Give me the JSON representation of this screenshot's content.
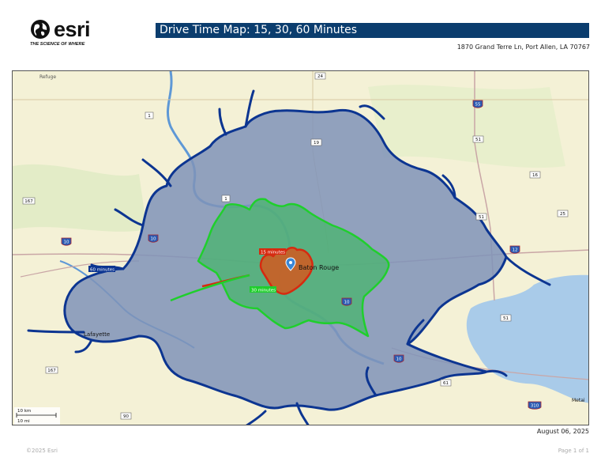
{
  "header": {
    "logo_word": "esri",
    "logo_tagline": "THE SCIENCE OF WHERE",
    "title": "Drive Time Map: 15, 30, 60 Minutes",
    "address": "1870 Grand Terre Ln, Port Allen, LA 70767"
  },
  "map": {
    "places": {
      "baton_rouge": "Baton Rouge",
      "lafayette": "Lafayette",
      "refuge": "Refuge",
      "metairie": "Metai"
    },
    "zone_labels": {
      "min15": "15 minutes",
      "min30": "30 minutes",
      "min60": "60 minutes"
    },
    "shields": {
      "s24": "24",
      "s1a": "1",
      "s1b": "1",
      "s19": "19",
      "s55": "55",
      "s51a": "51",
      "s51b": "51",
      "s16": "16",
      "s25": "25",
      "s167a": "167",
      "s167b": "167",
      "s10a": "10",
      "s10b": "10",
      "s10c": "10",
      "s10d": "10",
      "s61": "61",
      "s310": "310",
      "s90": "90",
      "s12": "12",
      "s51c": "51"
    },
    "scale": {
      "km": "10 km",
      "mi": "10 mi"
    },
    "colors": {
      "min60_fill": "#7f93b8",
      "min60_stroke": "#0c3591",
      "min30_fill": "#45b56a",
      "min30_stroke": "#1fcf2c",
      "min15_fill": "#d2591e",
      "min15_stroke": "#d62a10",
      "water": "#a9cbe9",
      "river": "#5e98d6",
      "land": "#f4f1d6"
    }
  },
  "footer": {
    "date": "August 06, 2025",
    "copyright": "©2025 Esri",
    "page": "Page 1 of 1"
  }
}
